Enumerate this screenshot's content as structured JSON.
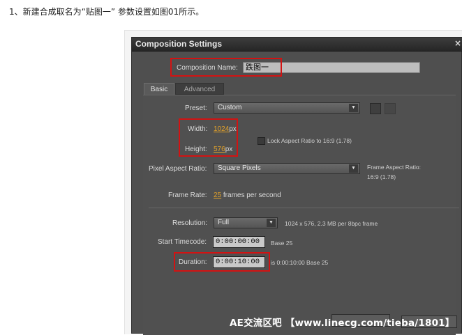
{
  "intro_text": "1、新建合成取名为“贴图一” 参数设置如图01所示。",
  "dialog": {
    "title": "Composition Settings",
    "close": "×"
  },
  "composition_name": {
    "label": "Composition Name:",
    "value": "跌图一"
  },
  "tabs": [
    {
      "label": "Basic"
    },
    {
      "label": "Advanced"
    }
  ],
  "preset": {
    "label": "Preset:",
    "value": "Custom"
  },
  "width": {
    "label": "Width:",
    "value": "1024",
    "unit": "px"
  },
  "height": {
    "label": "Height:",
    "value": "576",
    "unit": "px"
  },
  "lock_aspect": {
    "label": "Lock Aspect Ratio to 16:9 (1.78)",
    "checked": false
  },
  "pixel_aspect": {
    "label": "Pixel Aspect Ratio:",
    "value": "Square Pixels"
  },
  "frame_aspect": {
    "label": "Frame Aspect Ratio:",
    "value": "16:9 (1.78)"
  },
  "frame_rate": {
    "label": "Frame Rate:",
    "value": "25",
    "suffix": "frames per second"
  },
  "resolution": {
    "label": "Resolution:",
    "value": "Full",
    "info": "1024 x 576, 2.3 MB per 8bpc frame"
  },
  "start_timecode": {
    "label": "Start Timecode:",
    "value": "0:00:00:00",
    "base": "Base 25"
  },
  "duration": {
    "label": "Duration:",
    "value": "0:00:10:00",
    "info": "is 0:00:10:00  Base 25"
  },
  "watermark": "AE交流区吧 【www.linecg.com/tieba/1801】",
  "colors": {
    "highlight_box": "#d31212",
    "value_accent": "#e1a12a",
    "dialog_bg": "#4f4f4f"
  }
}
